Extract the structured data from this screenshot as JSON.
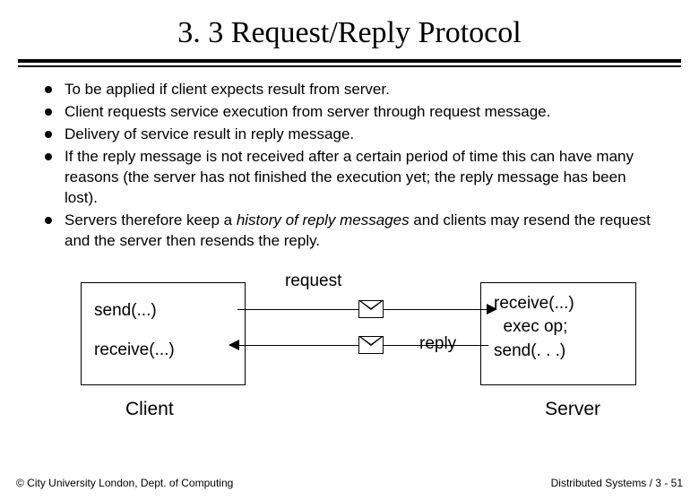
{
  "title": "3. 3 Request/Reply Protocol",
  "bullets": [
    "To be applied if client expects result from server.",
    "Client requests service execution from server through request message.",
    "Delivery of service result in reply message.",
    "If the reply message is not received after a certain period of time this can have many reasons (the server has not finished the execution yet; the reply message has been lost).",
    {
      "pre": "Servers therefore keep a ",
      "em": "history of reply messages",
      "post": " and clients may resend the request and the server then resends the reply."
    }
  ],
  "diagram": {
    "client_send": "send(...)",
    "client_recv": "receive(...)",
    "server_recv": "receive(...)",
    "server_exec": "  exec op;",
    "server_send": "send(. . .)",
    "request_label": "request",
    "reply_label": "reply",
    "client_label": "Client",
    "server_label": "Server"
  },
  "footer": {
    "left": "© City University London, Dept. of Computing",
    "right": "Distributed Systems / 3 - 51"
  }
}
